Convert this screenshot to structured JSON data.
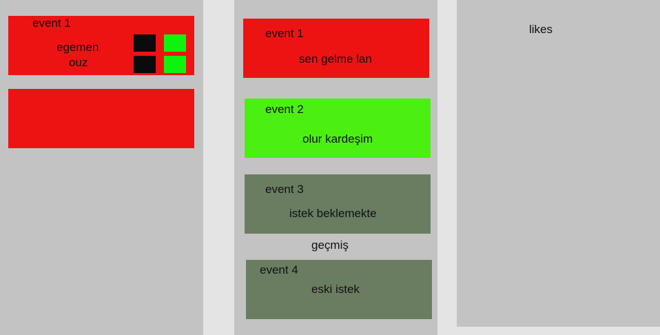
{
  "colors": {
    "panel": "#c3c3c3",
    "gap": "#e4e4e4",
    "red": "#ee1313",
    "green": "#4cef12",
    "olive": "#6a7d61",
    "black": "#0b0b0b",
    "bright_green": "#0ef30e"
  },
  "left": {
    "card1": {
      "title": "event 1",
      "name_1": "egemen",
      "name_2": "ouz"
    }
  },
  "middle": {
    "events": [
      {
        "title": "event 1",
        "status": "sen gelme lan"
      },
      {
        "title": "event 2",
        "status": "olur kardeşim"
      },
      {
        "title": "event 3",
        "status": "istek beklemekte"
      }
    ],
    "history_label": "geçmiş",
    "history": [
      {
        "title": "event 4",
        "status": "eski istek"
      }
    ]
  },
  "right": {
    "title": "likes"
  }
}
